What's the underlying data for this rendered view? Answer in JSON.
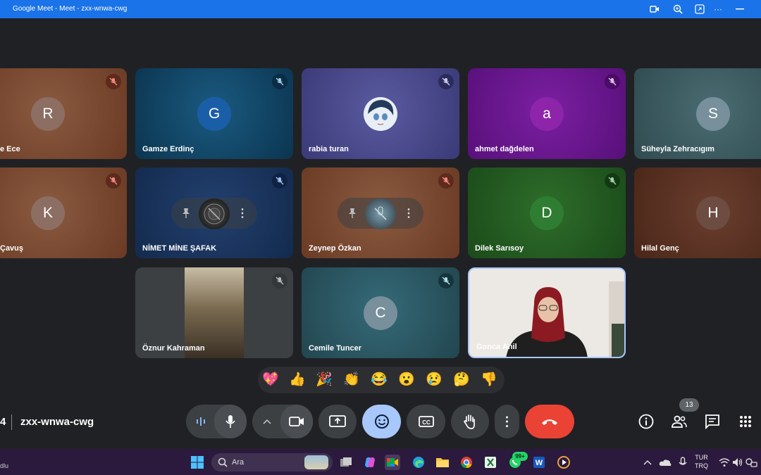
{
  "window": {
    "title": "Google Meet - Meet - zxx-wnwa-cwg"
  },
  "tiles": [
    {
      "name": "e Ece",
      "initial": "R",
      "avatar_color": "#8d6e63",
      "bg": "#7b4a32"
    },
    {
      "name": "Gamze Erdinç",
      "initial": "G",
      "avatar_color": "#1a5ea8",
      "bg": "#0e4a6e"
    },
    {
      "name": "rabia turan",
      "initial": "",
      "avatar_color": "",
      "bg": "#4a4a8c"
    },
    {
      "name": "ahmet dağdelen",
      "initial": "a",
      "avatar_color": "#8e24aa",
      "bg": "#6a1b9a"
    },
    {
      "name": "Süheyla Zehracıgım",
      "initial": "S",
      "avatar_color": "#78909c",
      "bg": "#3f5e64"
    },
    {
      "name": "Çavuş",
      "initial": "K",
      "avatar_color": "#8d6e63",
      "bg": "#7b4a32"
    },
    {
      "name": "NİMET MİNE ŞAFAK",
      "initial": "",
      "avatar_color": "",
      "bg": "#1d3460"
    },
    {
      "name": "Zeynep Özkan",
      "initial": "",
      "avatar_color": "",
      "bg": "#7b4a32"
    },
    {
      "name": "Dilek Sarısoy",
      "initial": "D",
      "avatar_color": "#2e7d32",
      "bg": "#1f5a1f"
    },
    {
      "name": "Hilal Genç",
      "initial": "H",
      "avatar_color": "#6d4c41",
      "bg": "#5d3425"
    },
    {
      "name": "Öznur Kahraman",
      "initial": "",
      "avatar_color": "",
      "bg": "#3c4043"
    },
    {
      "name": "Cemile Tuncer",
      "initial": "C",
      "avatar_color": "#78909c",
      "bg": "#2c5563"
    },
    {
      "name": "Gonca Anil",
      "initial": "",
      "avatar_color": "",
      "bg": "#e8e4e0"
    }
  ],
  "reactions": [
    "💖",
    "👍",
    "🎉",
    "👏",
    "😂",
    "😮",
    "😢",
    "🤔",
    "👎"
  ],
  "bottom_bar": {
    "meeting_code": "zxx-wnwa-cwg",
    "participants_count": "13",
    "end_call_color": "#ea4335",
    "emoji_active_color": "#a8c7fa"
  },
  "taskbar": {
    "search_placeholder": "Ara",
    "whatsapp_badge": "99+",
    "language": "TUR",
    "keyboard": "TRQ",
    "left_fragment": "dlu"
  }
}
